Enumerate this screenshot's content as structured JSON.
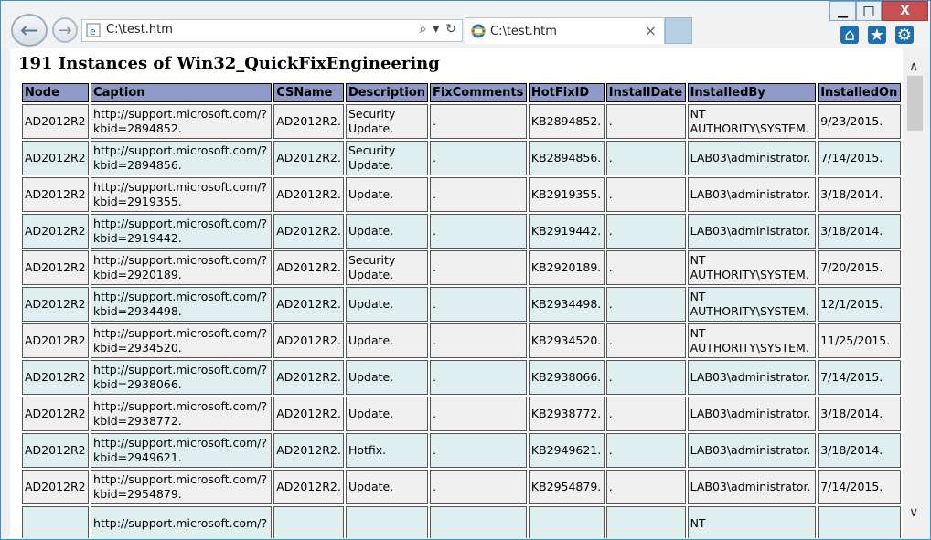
{
  "browser": {
    "address": "C:\\test.htm",
    "tab_title": "C:\\test.htm",
    "tab_close": "×",
    "back": "←",
    "forward": "→",
    "search_glyph": "⌕",
    "dropdown_glyph": "▾",
    "refresh_glyph": "↻",
    "home_glyph": "⌂",
    "favorites_glyph": "★",
    "settings_glyph": "⚙",
    "min": "▁",
    "max": "□",
    "close": "X"
  },
  "page": {
    "heading": "191 Instances of Win32_QuickFixEngineering"
  },
  "table": {
    "headers": [
      "Node",
      "Caption",
      "CSName",
      "Description",
      "FixComments",
      "HotFixID",
      "InstallDate",
      "InstalledBy",
      "InstalledOn"
    ],
    "rows": [
      {
        "node": "AD2012R2",
        "caption1": "http://support.microsoft.com/?",
        "caption2": "kbid=2894852.",
        "csname": "AD2012R2.",
        "desc1": "Security",
        "desc2": "Update.",
        "fix": ".",
        "hotfix": "KB2894852.",
        "idate": ".",
        "by1": "NT",
        "by2": "AUTHORITY\\SYSTEM.",
        "on": "9/23/2015."
      },
      {
        "node": "AD2012R2",
        "caption1": "http://support.microsoft.com/?",
        "caption2": "kbid=2894856.",
        "csname": "AD2012R2.",
        "desc1": "Security",
        "desc2": "Update.",
        "fix": ".",
        "hotfix": "KB2894856.",
        "idate": ".",
        "by1": "LAB03\\administrator.",
        "by2": "",
        "on": "7/14/2015."
      },
      {
        "node": "AD2012R2",
        "caption1": "http://support.microsoft.com/?",
        "caption2": "kbid=2919355.",
        "csname": "AD2012R2.",
        "desc1": "Update.",
        "desc2": "",
        "fix": ".",
        "hotfix": "KB2919355.",
        "idate": ".",
        "by1": "LAB03\\administrator.",
        "by2": "",
        "on": "3/18/2014."
      },
      {
        "node": "AD2012R2",
        "caption1": "http://support.microsoft.com/?",
        "caption2": "kbid=2919442.",
        "csname": "AD2012R2.",
        "desc1": "Update.",
        "desc2": "",
        "fix": ".",
        "hotfix": "KB2919442.",
        "idate": ".",
        "by1": "LAB03\\administrator.",
        "by2": "",
        "on": "3/18/2014."
      },
      {
        "node": "AD2012R2",
        "caption1": "http://support.microsoft.com/?",
        "caption2": "kbid=2920189.",
        "csname": "AD2012R2.",
        "desc1": "Security",
        "desc2": "Update.",
        "fix": ".",
        "hotfix": "KB2920189.",
        "idate": ".",
        "by1": "NT",
        "by2": "AUTHORITY\\SYSTEM.",
        "on": "7/20/2015."
      },
      {
        "node": "AD2012R2",
        "caption1": "http://support.microsoft.com/?",
        "caption2": "kbid=2934498.",
        "csname": "AD2012R2.",
        "desc1": "Update.",
        "desc2": "",
        "fix": ".",
        "hotfix": "KB2934498.",
        "idate": ".",
        "by1": "NT",
        "by2": "AUTHORITY\\SYSTEM.",
        "on": "12/1/2015."
      },
      {
        "node": "AD2012R2",
        "caption1": "http://support.microsoft.com/?",
        "caption2": "kbid=2934520.",
        "csname": "AD2012R2.",
        "desc1": "Update.",
        "desc2": "",
        "fix": ".",
        "hotfix": "KB2934520.",
        "idate": ".",
        "by1": "NT",
        "by2": "AUTHORITY\\SYSTEM.",
        "on": "11/25/2015."
      },
      {
        "node": "AD2012R2",
        "caption1": "http://support.microsoft.com/?",
        "caption2": "kbid=2938066.",
        "csname": "AD2012R2.",
        "desc1": "Update.",
        "desc2": "",
        "fix": ".",
        "hotfix": "KB2938066.",
        "idate": ".",
        "by1": "LAB03\\administrator.",
        "by2": "",
        "on": "7/14/2015."
      },
      {
        "node": "AD2012R2",
        "caption1": "http://support.microsoft.com/?",
        "caption2": "kbid=2938772.",
        "csname": "AD2012R2.",
        "desc1": "Update.",
        "desc2": "",
        "fix": ".",
        "hotfix": "KB2938772.",
        "idate": ".",
        "by1": "LAB03\\administrator.",
        "by2": "",
        "on": "3/18/2014."
      },
      {
        "node": "AD2012R2",
        "caption1": "http://support.microsoft.com/?",
        "caption2": "kbid=2949621.",
        "csname": "AD2012R2.",
        "desc1": "Hotfix.",
        "desc2": "",
        "fix": ".",
        "hotfix": "KB2949621.",
        "idate": ".",
        "by1": "LAB03\\administrator.",
        "by2": "",
        "on": "3/18/2014."
      },
      {
        "node": "AD2012R2",
        "caption1": "http://support.microsoft.com/?",
        "caption2": "kbid=2954879.",
        "csname": "AD2012R2.",
        "desc1": "Update.",
        "desc2": "",
        "fix": ".",
        "hotfix": "KB2954879.",
        "idate": ".",
        "by1": "LAB03\\administrator.",
        "by2": "",
        "on": "7/14/2015."
      },
      {
        "node": "",
        "caption1": "http://support.microsoft.com/?",
        "caption2": "",
        "csname": "",
        "desc1": "",
        "desc2": "",
        "fix": "",
        "hotfix": "",
        "idate": "",
        "by1": "NT",
        "by2": "",
        "on": ""
      }
    ]
  }
}
